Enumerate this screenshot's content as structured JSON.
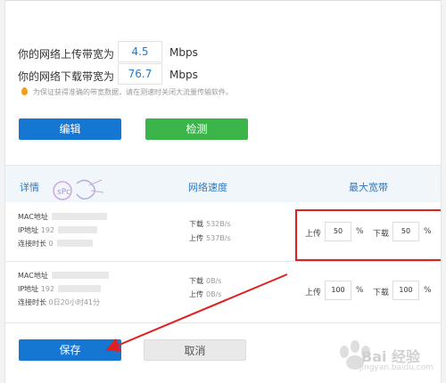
{
  "bandwidth": {
    "upload_label": "你的网络上传带宽为",
    "upload_value": "4.5",
    "download_label": "你的网络下载带宽为",
    "download_value": "76.7",
    "unit": "Mbps",
    "tip": "为保证获得准确的带宽数据，请在测速时关闭大流量传输软件。"
  },
  "buttons": {
    "edit": "编辑",
    "test": "检测",
    "save": "保存",
    "cancel": "取消"
  },
  "table": {
    "headers": {
      "details": "详情",
      "speed": "网络速度",
      "max_bandwidth": "最大宽带"
    },
    "devices": [
      {
        "mac_label": "MAC地址",
        "ip_label": "IP地址",
        "ip_prefix": "192",
        "conn_label": "连接时长",
        "conn_value": "0",
        "download_label": "下载",
        "download_speed": "532B/s",
        "upload_label": "上传",
        "upload_speed": "537B/s",
        "limit_upload_label": "上传",
        "limit_upload": "50",
        "limit_download_label": "下载",
        "limit_download": "50",
        "pct": "%"
      },
      {
        "mac_label": "MAC地址",
        "ip_label": "IP地址",
        "ip_prefix": "192",
        "conn_label": "连接时长",
        "conn_value": "0日20小时41分",
        "download_label": "下载",
        "download_speed": "0B/s",
        "upload_label": "上传",
        "upload_speed": "0B/s",
        "limit_upload_label": "上传",
        "limit_upload": "100",
        "limit_download_label": "下载",
        "limit_download": "100",
        "pct": "%"
      }
    ]
  },
  "watermark": {
    "text": "Bai 经验",
    "url": "jingyan.baidu.com"
  },
  "colors": {
    "primary": "#1677d2",
    "success": "#3bb54a",
    "highlight": "#e02020"
  }
}
